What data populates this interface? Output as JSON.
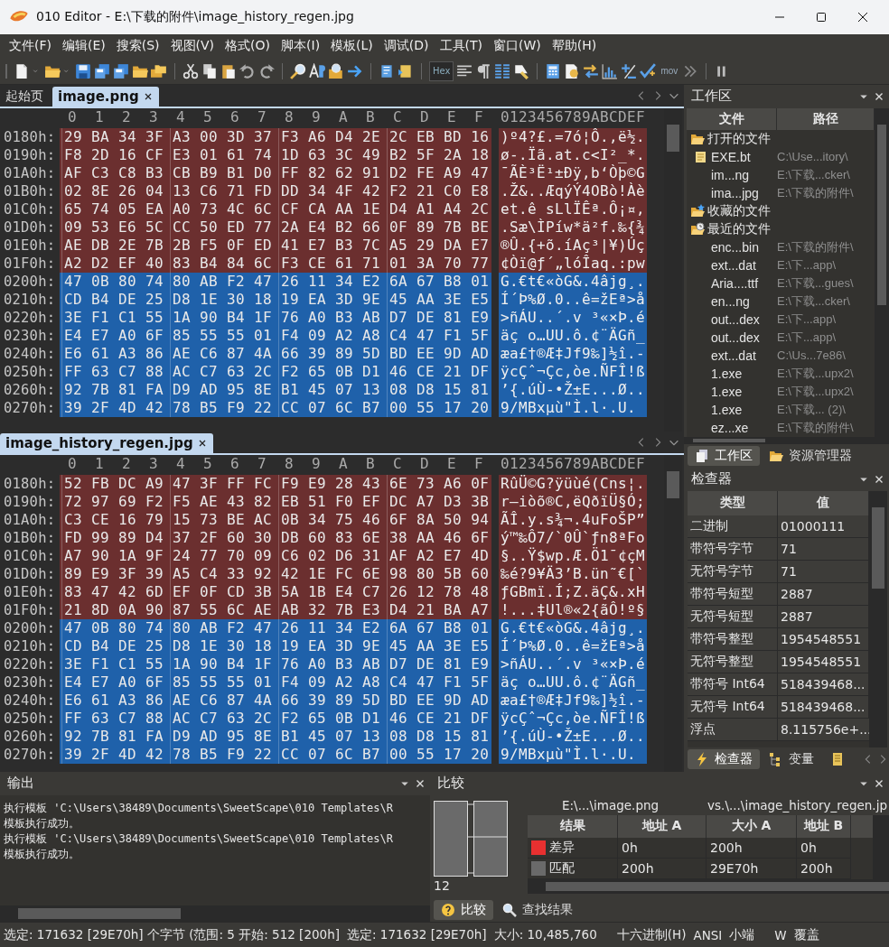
{
  "window": {
    "title": "010 Editor - E:\\下载的附件\\image_history_regen.jpg"
  },
  "menu": [
    "文件(F)",
    "编辑(E)",
    "搜索(S)",
    "视图(V)",
    "格式(O)",
    "脚本(I)",
    "模板(L)",
    "调试(D)",
    "工具(T)",
    "窗口(W)",
    "帮助(H)"
  ],
  "toolbar": {
    "hex_label": "Hex",
    "mov_label": "mov"
  },
  "editors": [
    {
      "tabs": [
        {
          "label": "起始页",
          "selected": false
        },
        {
          "label": "image.png",
          "selected": true
        }
      ],
      "columns": [
        "0",
        "1",
        "2",
        "3",
        "4",
        "5",
        "6",
        "7",
        "8",
        "9",
        "A",
        "B",
        "C",
        "D",
        "E",
        "F"
      ],
      "ascii_header": "0123456789ABCDEF",
      "rows": [
        {
          "offset": "0180h:",
          "hex": "29 BA 34 3F A3 00 3D 37 F3 A6 D4 2E 2C EB BD 16",
          "ascii": ")º4?£.=7ó¦Ô.,ë½.",
          "differs": true
        },
        {
          "offset": "0190h:",
          "hex": "F8 2D 16 CF E3 01 61 74 1D 63 3C 49 B2 5F 2A 18",
          "ascii": "ø-.Ïã.at.c<I²_*.",
          "differs": true
        },
        {
          "offset": "01A0h:",
          "hex": "AF C3 C8 B3 CB B9 B1 D0 FF 82 62 91 D2 FE A9 47",
          "ascii": "¯ÃÈ³Ë¹±Ðÿ‚b‘Òþ©G",
          "differs": true
        },
        {
          "offset": "01B0h:",
          "hex": "02 8E 26 04 13 C6 71 FD DD 34 4F 42 F2 21 C0 E8",
          "ascii": ".Ž&..ÆqýÝ4OBò!Àè",
          "differs": true
        },
        {
          "offset": "01C0h:",
          "hex": "65 74 05 EA A0 73 4C 6C CF CA AA 1E D4 A1 A4 2C",
          "ascii": "et.ê sLlÏÊª.Ô¡¤,",
          "differs": true
        },
        {
          "offset": "01D0h:",
          "hex": "09 53 E6 5C CC 50 ED 77 2A E4 B2 66 0F 89 7B BE",
          "ascii": ".Sæ\\ÌPíw*ä²f.‰{¾",
          "differs": true
        },
        {
          "offset": "01E0h:",
          "hex": "AE DB 2E 7B 2B F5 0F ED 41 E7 B3 7C A5 29 DA E7",
          "ascii": "®Û.{+õ.íAç³|¥)Úç",
          "differs": true
        },
        {
          "offset": "01F0h:",
          "hex": "A2 D2 EF 40 83 B4 84 6C F3 CE 61 71 01 3A 70 77",
          "ascii": "¢Òï@ƒ´„lóÎaq.:pw",
          "differs": true
        },
        {
          "offset": "0200h:",
          "hex": "47 0B 80 74 80 AB F2 47 26 11 34 E2 6A 67 B8 01",
          "ascii": "G.€t€«òG&.4âjg¸.",
          "differs": false
        },
        {
          "offset": "0210h:",
          "hex": "CD B4 DE 25 D8 1E 30 18 19 EA 3D 9E 45 AA 3E E5",
          "ascii": "Í´Þ%Ø.0..ê=žEª>å",
          "differs": false
        },
        {
          "offset": "0220h:",
          "hex": "3E F1 C1 55 1A 90 B4 1F 76 A0 B3 AB D7 DE 81 E9",
          "ascii": ">ñÁU..´.v ³«×Þ.é",
          "differs": false
        },
        {
          "offset": "0230h:",
          "hex": "E4 E7 A0 6F 85 55 55 01 F4 09 A2 A8 C4 47 F1 5F",
          "ascii": "äç o…UU.ô.¢¨ÄGñ_",
          "differs": false
        },
        {
          "offset": "0240h:",
          "hex": "E6 61 A3 86 AE C6 87 4A 66 39 89 5D BD EE 9D AD",
          "ascii": "æa£†®Æ‡Jf9‰]½î.-",
          "differs": false
        },
        {
          "offset": "0250h:",
          "hex": "FF 63 C7 88 AC C7 63 2C F2 65 0B D1 46 CE 21 DF",
          "ascii": "ÿcÇˆ¬Çc,òe.ÑFÎ!ß",
          "differs": false
        },
        {
          "offset": "0260h:",
          "hex": "92 7B 81 FA D9 AD 95 8E B1 45 07 13 08 D8 15 81",
          "ascii": "’{.úÙ-•Ž±E...Ø..",
          "differs": false
        },
        {
          "offset": "0270h:",
          "hex": "39 2F 4D 42 78 B5 F9 22 CC 07 6C B7 00 55 17 20",
          "ascii": "9/MBxµù\"Ì.l·.U.",
          "differs": false
        }
      ]
    },
    {
      "tabs": [
        {
          "label": "image_history_regen.jpg",
          "selected": true
        }
      ],
      "columns": [
        "0",
        "1",
        "2",
        "3",
        "4",
        "5",
        "6",
        "7",
        "8",
        "9",
        "A",
        "B",
        "C",
        "D",
        "E",
        "F"
      ],
      "ascii_header": "0123456789ABCDEF",
      "rows": [
        {
          "offset": "0180h:",
          "hex": "52 FB DC A9 47 3F FF FC F9 E9 28 43 6E 73 A6 0F",
          "ascii": "RûÜ©G?ÿüùé(Cns¦.",
          "differs": true
        },
        {
          "offset": "0190h:",
          "hex": "72 97 69 F2 F5 AE 43 82 EB 51 F0 EF DC A7 D3 3B",
          "ascii": "r—iòõ®C‚ëQðïÜ§Ó;",
          "differs": true
        },
        {
          "offset": "01A0h:",
          "hex": "C3 CE 16 79 15 73 BE AC 0B 34 75 46 6F 8A 50 94",
          "ascii": "ÃÎ.y.s¾¬.4uFoŠP”",
          "differs": true
        },
        {
          "offset": "01B0h:",
          "hex": "FD 99 89 D4 37 2F 60 30 DB 60 83 6E 38 AA 46 6F",
          "ascii": "ý™‰Ô7/`0Û`ƒn8ªFo",
          "differs": true
        },
        {
          "offset": "01C0h:",
          "hex": "A7 90 1A 9F 24 77 70 09 C6 02 D6 31 AF A2 E7 4D",
          "ascii": "§..Ÿ$wp.Æ.Ö1¯¢çM",
          "differs": true
        },
        {
          "offset": "01D0h:",
          "hex": "89 E9 3F 39 A5 C4 33 92 42 1E FC 6E 98 80 5B 60",
          "ascii": "‰é?9¥Ä3’B.ün˜€[`",
          "differs": true
        },
        {
          "offset": "01E0h:",
          "hex": "83 47 42 6D EF 0F CD 3B 5A 1B E4 C7 26 12 78 48",
          "ascii": "ƒGBmï.Í;Z.äÇ&.xH",
          "differs": true
        },
        {
          "offset": "01F0h:",
          "hex": "21 8D 0A 90 87 55 6C AE AB 32 7B E3 D4 21 BA A7",
          "ascii": "!...‡Ul®«2{ãÔ!º§",
          "differs": true
        },
        {
          "offset": "0200h:",
          "hex": "47 0B 80 74 80 AB F2 47 26 11 34 E2 6A 67 B8 01",
          "ascii": "G.€t€«òG&.4âjg¸.",
          "differs": false
        },
        {
          "offset": "0210h:",
          "hex": "CD B4 DE 25 D8 1E 30 18 19 EA 3D 9E 45 AA 3E E5",
          "ascii": "Í´Þ%Ø.0..ê=žEª>å",
          "differs": false
        },
        {
          "offset": "0220h:",
          "hex": "3E F1 C1 55 1A 90 B4 1F 76 A0 B3 AB D7 DE 81 E9",
          "ascii": ">ñÁU..´.v ³«×Þ.é",
          "differs": false
        },
        {
          "offset": "0230h:",
          "hex": "E4 E7 A0 6F 85 55 55 01 F4 09 A2 A8 C4 47 F1 5F",
          "ascii": "äç o…UU.ô.¢¨ÄGñ_",
          "differs": false
        },
        {
          "offset": "0240h:",
          "hex": "E6 61 A3 86 AE C6 87 4A 66 39 89 5D BD EE 9D AD",
          "ascii": "æa£†®Æ‡Jf9‰]½î.-",
          "differs": false
        },
        {
          "offset": "0250h:",
          "hex": "FF 63 C7 88 AC C7 63 2C F2 65 0B D1 46 CE 21 DF",
          "ascii": "ÿcÇˆ¬Çc,òe.ÑFÎ!ß",
          "differs": false
        },
        {
          "offset": "0260h:",
          "hex": "92 7B 81 FA D9 AD 95 8E B1 45 07 13 08 D8 15 81",
          "ascii": "’{.úÙ-•Ž±E...Ø..",
          "differs": false
        },
        {
          "offset": "0270h:",
          "hex": "39 2F 4D 42 78 B5 F9 22 CC 07 6C B7 00 55 17 20",
          "ascii": "9/MBxµù\"Ì.l·.U.",
          "differs": false
        }
      ]
    }
  ],
  "workspace": {
    "title": "工作区",
    "columns": [
      "文件",
      "路径"
    ],
    "groups": [
      {
        "name": "打开的文件",
        "children": [
          {
            "name": "EXE.bt",
            "path": "C:\\Use...itory\\",
            "kind": "template"
          },
          {
            "name": "im...ng",
            "path": "E:\\下载...cker\\",
            "kind": "file"
          },
          {
            "name": "ima...jpg",
            "path": "E:\\下载的附件\\",
            "kind": "file"
          }
        ]
      },
      {
        "name": "收藏的文件"
      },
      {
        "name": "最近的文件",
        "children": [
          {
            "name": "enc...bin",
            "path": "E:\\下载的附件\\",
            "kind": "file"
          },
          {
            "name": "ext...dat",
            "path": "E:\\下...app\\",
            "kind": "file"
          },
          {
            "name": "Aria....ttf",
            "path": "E:\\下载...gues\\",
            "kind": "file"
          },
          {
            "name": "en...ng",
            "path": "E:\\下载...cker\\",
            "kind": "file"
          },
          {
            "name": "out...dex",
            "path": "E:\\下...app\\",
            "kind": "file"
          },
          {
            "name": "out...dex",
            "path": "E:\\下...app\\",
            "kind": "file"
          },
          {
            "name": "ext...dat",
            "path": "C:\\Us...7e86\\",
            "kind": "file"
          },
          {
            "name": "1.exe",
            "path": "E:\\下载...upx2\\",
            "kind": "file"
          },
          {
            "name": "1.exe",
            "path": "E:\\下载...upx2\\",
            "kind": "file"
          },
          {
            "name": "1.exe",
            "path": "E:\\下载... (2)\\",
            "kind": "file"
          },
          {
            "name": "ez...xe",
            "path": "E:\\下载的附件\\",
            "kind": "file"
          }
        ]
      }
    ]
  },
  "workspace_tabs": [
    {
      "label": "工作区",
      "selected": true
    },
    {
      "label": "资源管理器",
      "selected": false
    }
  ],
  "inspector": {
    "title": "检查器",
    "columns": [
      "类型",
      "值"
    ],
    "rows": [
      {
        "type": "二进制",
        "value": "01000111"
      },
      {
        "type": "带符号字节",
        "value": "71"
      },
      {
        "type": "无符号字节",
        "value": "71"
      },
      {
        "type": "带符号短型",
        "value": "2887"
      },
      {
        "type": "无符号短型",
        "value": "2887"
      },
      {
        "type": "带符号整型",
        "value": "1954548551"
      },
      {
        "type": "无符号整型",
        "value": "1954548551"
      },
      {
        "type": "带符号 Int64",
        "value": "518439468..."
      },
      {
        "type": "无符号 Int64",
        "value": "518439468..."
      },
      {
        "type": "浮点",
        "value": "8.115756e+..."
      }
    ]
  },
  "inspector_tabs": [
    {
      "label": "检查器",
      "selected": true
    },
    {
      "label": "变量",
      "selected": false
    }
  ],
  "output": {
    "title": "输出",
    "lines": [
      "执行模板 'C:\\Users\\38489\\Documents\\SweetScape\\010 Templates\\R",
      "模板执行成功。",
      "执行模板 'C:\\Users\\38489\\Documents\\SweetScape\\010 Templates\\R",
      "模板执行成功。"
    ]
  },
  "compare": {
    "title": "比较",
    "count": "12",
    "file_a": "E:\\...\\image.png",
    "file_b": "vs.\\...\\image_history_regen.jp",
    "columns": [
      "结果",
      "地址 A",
      "大小 A",
      "地址 B"
    ],
    "rows": [
      {
        "result": "差异",
        "color": "#e83030",
        "cells": [
          "0h",
          "200h",
          "0h"
        ]
      },
      {
        "result": "匹配",
        "color": "#6a6a6a",
        "cells": [
          "200h",
          "29E70h",
          "200h"
        ]
      }
    ]
  },
  "bottom_tabs": [
    {
      "label": "比较",
      "selected": true
    },
    {
      "label": "查找结果",
      "selected": false
    }
  ],
  "status_bar": [
    "选定: 171632 [29E70h] 个字节 (范围: 5 开始: 512 [200h]",
    "选定: 171632 [29E70h]",
    "大小: 10,485,760",
    "十六进制(H)",
    "ANSI",
    "小端",
    "W",
    "覆盖"
  ]
}
